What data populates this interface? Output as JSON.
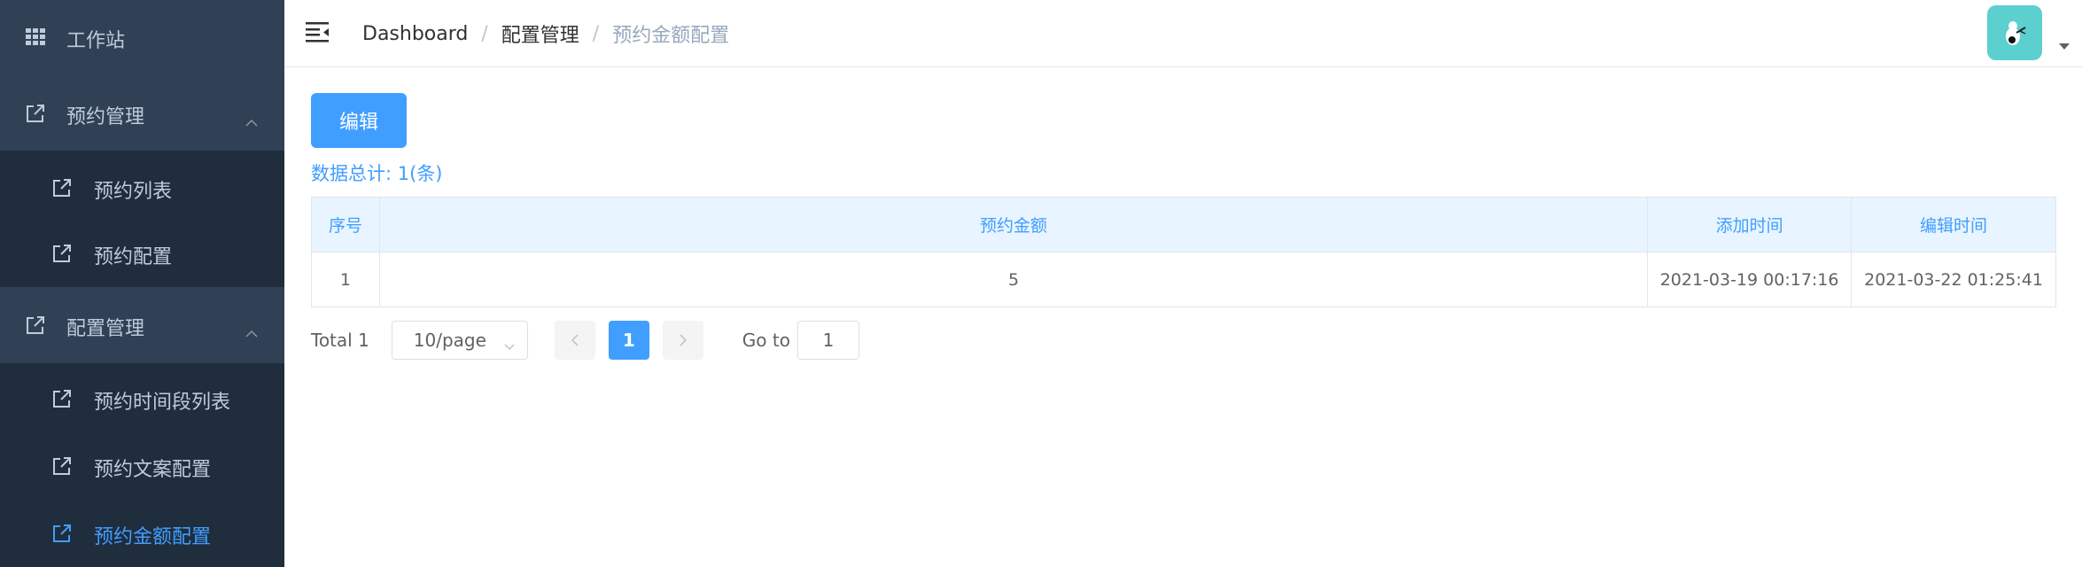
{
  "sidebar": {
    "items": [
      {
        "label": "工作站",
        "icon": "grid-icon",
        "level": "top"
      },
      {
        "label": "预约管理",
        "icon": "external-link-icon",
        "level": "top",
        "expanded": true
      },
      {
        "label": "预约列表",
        "icon": "external-link-icon",
        "level": "sub"
      },
      {
        "label": "预约配置",
        "icon": "external-link-icon",
        "level": "sub"
      },
      {
        "label": "配置管理",
        "icon": "external-link-icon",
        "level": "top",
        "expanded": true
      },
      {
        "label": "预约时间段列表",
        "icon": "external-link-icon",
        "level": "sub"
      },
      {
        "label": "预约文案配置",
        "icon": "external-link-icon",
        "level": "sub"
      },
      {
        "label": "预约金额配置",
        "icon": "external-link-icon",
        "level": "sub",
        "active": true
      }
    ]
  },
  "header": {
    "breadcrumb": [
      "Dashboard",
      "配置管理",
      "预约金额配置"
    ],
    "separator": "/"
  },
  "main": {
    "edit_label": "编辑",
    "summary": "数据总计: 1(条)",
    "table": {
      "columns": [
        "序号",
        "预约金额",
        "添加时间",
        "编辑时间"
      ],
      "rows": [
        [
          "1",
          "5",
          "2021-03-19 00:17:16",
          "2021-03-22 01:25:41"
        ]
      ]
    },
    "pagination": {
      "total": "Total 1",
      "page_size": "10/page",
      "current_page": "1",
      "goto_label": "Go to",
      "goto_value": "1"
    }
  },
  "colors": {
    "sidebar_bg": "#304156",
    "submenu_bg": "#1f2d3d",
    "accent": "#409eff",
    "avatar_bg": "#5ccfcf"
  }
}
